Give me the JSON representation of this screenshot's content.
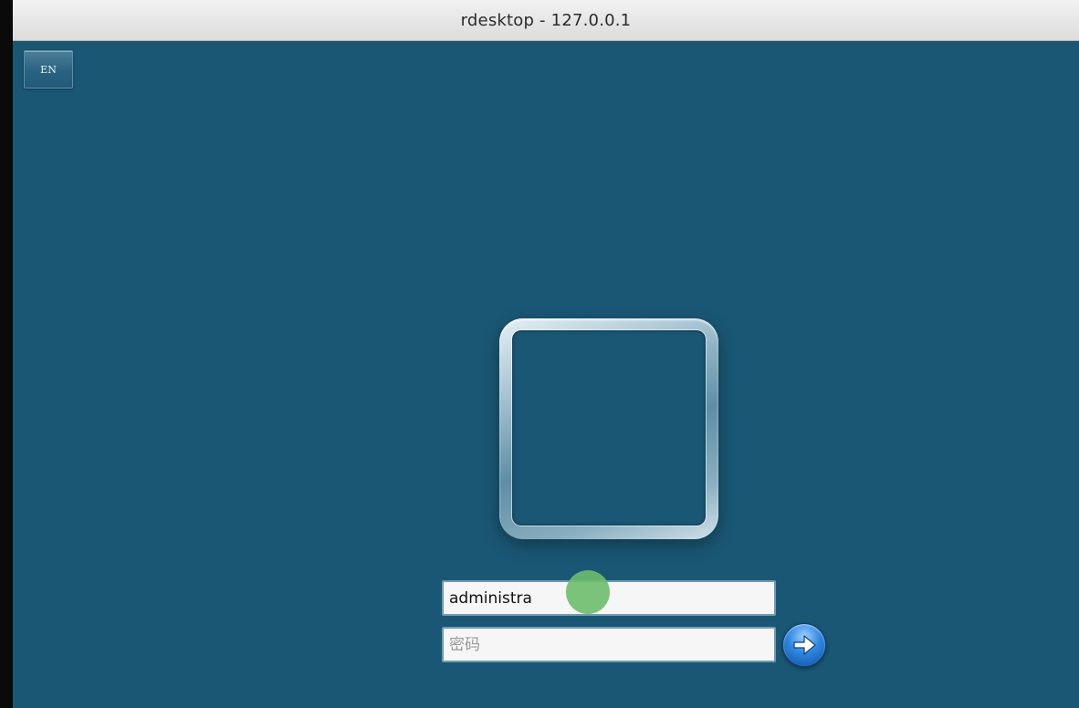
{
  "window": {
    "title": "rdesktop - 127.0.0.1"
  },
  "desktop": {
    "background_color": "#1a5774"
  },
  "language_button": {
    "label": "EN"
  },
  "login": {
    "avatar_icon": "user-tile-icon",
    "username_value": "administra",
    "password_placeholder": "密码",
    "submit_icon": "arrow-right-icon"
  }
}
